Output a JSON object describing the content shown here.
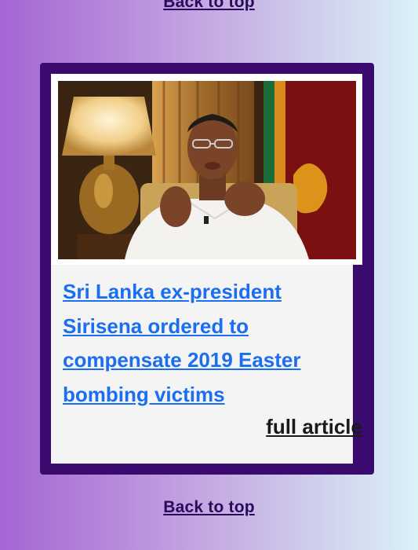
{
  "nav": {
    "back_to_top_label": "Back to top"
  },
  "article": {
    "headline": "Sri Lanka ex-president Sirisena ordered to compensate 2019 Easter bombing victims",
    "full_article_label": "full article",
    "image_alt": "Man in white shirt gesturing, seated in front of a lamp and Sri Lankan flag"
  },
  "colors": {
    "frame": "#3a0a6e",
    "link": "#1a6ef0",
    "back_link": "#2a0a5c"
  }
}
